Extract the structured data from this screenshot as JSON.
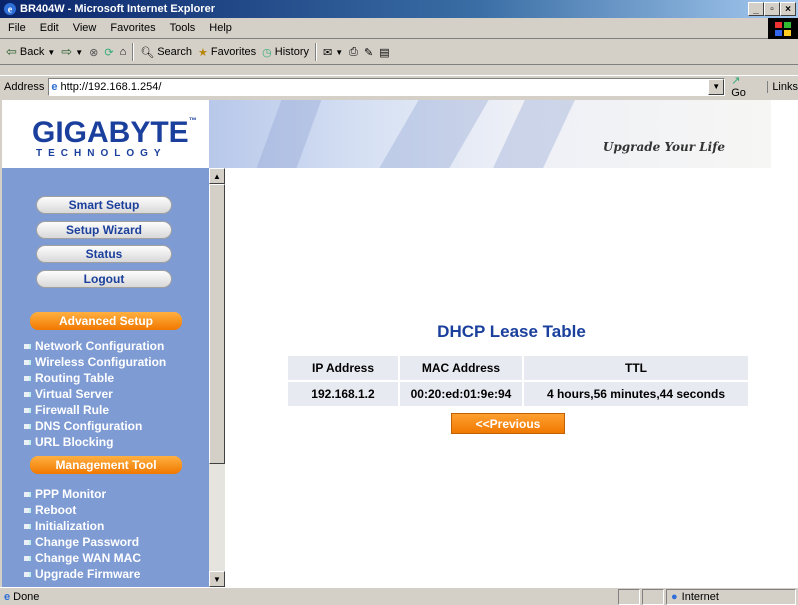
{
  "window": {
    "title": "BR404W - Microsoft Internet Explorer"
  },
  "menu": {
    "items": [
      "File",
      "Edit",
      "View",
      "Favorites",
      "Tools",
      "Help"
    ]
  },
  "toolbar": {
    "back": "Back",
    "search": "Search",
    "favorites": "Favorites",
    "history": "History"
  },
  "address": {
    "label": "Address",
    "url": "http://192.168.1.254/",
    "go": "Go",
    "links": "Links"
  },
  "banner": {
    "logo": "GIGABYTE",
    "logo_sub": "TECHNOLOGY",
    "slogan": "Upgrade Your Life"
  },
  "sidebar": {
    "buttons": [
      "Smart Setup",
      "Setup Wizard",
      "Status",
      "Logout"
    ],
    "advanced_header": "Advanced Setup",
    "advanced_items": [
      "Network Configuration",
      "Wireless Configuration",
      "Routing Table",
      "Virtual Server",
      "Firewall Rule",
      "DNS Configuration",
      "URL Blocking"
    ],
    "management_header": "Management Tool",
    "management_items": [
      "PPP Monitor",
      "Reboot",
      "Initialization",
      "Change Password",
      "Change WAN MAC",
      "Upgrade Firmware"
    ]
  },
  "main": {
    "title": "DHCP Lease Table",
    "columns": [
      "IP Address",
      "MAC Address",
      "TTL"
    ],
    "rows": [
      [
        "192.168.1.2",
        "00:20:ed:01:9e:94",
        "4 hours,56 minutes,44 seconds"
      ]
    ],
    "previous_button": "<<Previous"
  },
  "status": {
    "text": "Done",
    "zone": "Internet"
  }
}
